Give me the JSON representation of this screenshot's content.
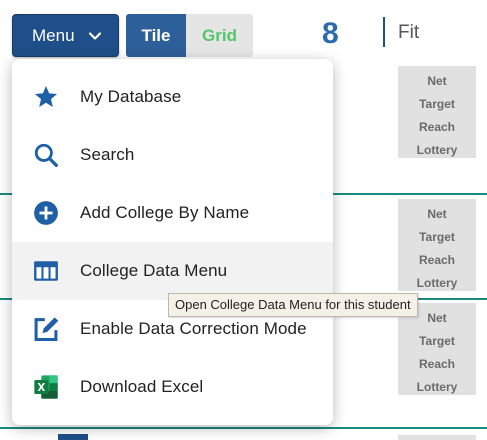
{
  "toolbar": {
    "menu_label": "Menu",
    "tile_label": "Tile",
    "grid_label": "Grid",
    "count": "8",
    "fit_label": "Fit"
  },
  "fit_categories": [
    "Net",
    "Target",
    "Reach",
    "Lottery"
  ],
  "menu": {
    "items": [
      {
        "label": "My Database",
        "icon": "star-icon"
      },
      {
        "label": "Search",
        "icon": "search-icon"
      },
      {
        "label": "Add College By Name",
        "icon": "plus-circle-icon"
      },
      {
        "label": "College Data Menu",
        "icon": "table-icon"
      },
      {
        "label": "Enable Data Correction Mode",
        "icon": "edit-icon"
      },
      {
        "label": "Download Excel",
        "icon": "excel-icon"
      }
    ]
  },
  "tooltip": "Open College Data Menu for this student",
  "colors": {
    "brand_blue": "#1f4f88",
    "icon_blue": "#1f5fa6",
    "accent_green": "#55c56a",
    "divider_teal": "#1a8a7f",
    "excel_green": "#1d7a45"
  }
}
